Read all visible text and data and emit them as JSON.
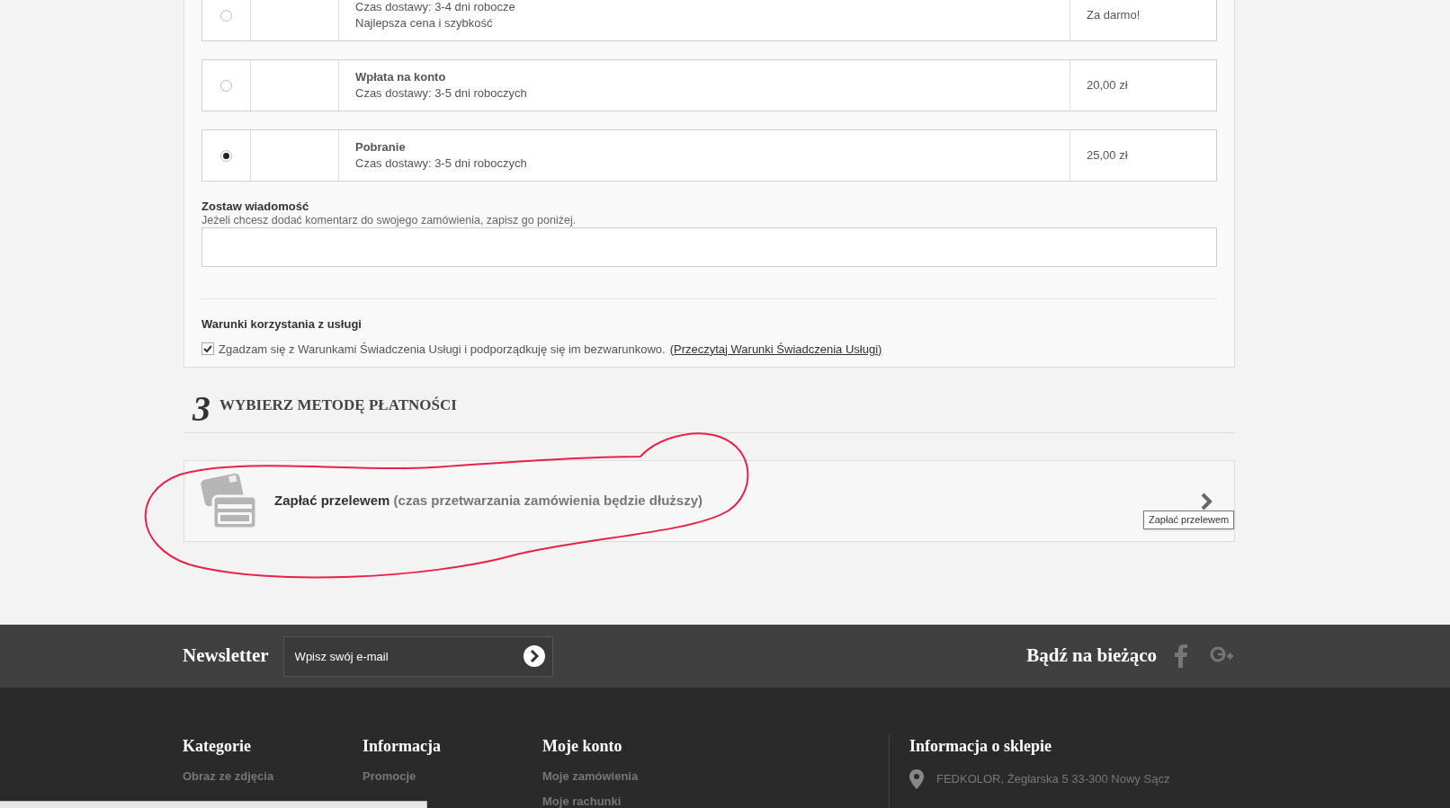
{
  "shipping_options": [
    {
      "selected": false,
      "lines": [
        "Czas dostawy: 3-4 dni robocze",
        "Najlepsza cena i szybkość"
      ],
      "price": "Za darmo!"
    },
    {
      "selected": false,
      "name": "Wpłata na konto",
      "lines": [
        "Czas dostawy: 3-5 dni roboczych"
      ],
      "price": "20,00 zł"
    },
    {
      "selected": true,
      "name": "Pobranie",
      "lines": [
        "Czas dostawy: 3-5 dni roboczych"
      ],
      "price": "25,00 zł"
    }
  ],
  "message": {
    "title": "Zostaw wiadomość",
    "hint": "Jeżeli chcesz dodać komentarz do swojego zamówienia, zapisz go poniżej."
  },
  "terms": {
    "title": "Warunki korzystania z usługi",
    "checked": true,
    "text": "Zgadzam się z Warunkami Świadczenia Usługi i podporządkuję się im bezwarunkowo.",
    "link": "(Przeczytaj Warunki Świadczenia Usługi)"
  },
  "payment_step": {
    "number": "3",
    "title": "WYBIERZ METODĘ PŁATNOŚCI",
    "method": "Zapłać przelewem",
    "note": "(czas przetwarzania zamówienia będzie dłuższy)",
    "tooltip": "Zapłać przelewem"
  },
  "newsletter": {
    "title": "Newsletter",
    "placeholder": "Wpisz swój e-mail",
    "social_title": "Bądź na bieżąco"
  },
  "footer": {
    "columns": [
      {
        "title": "Kategorie",
        "links": [
          "Obraz ze zdjęcia"
        ]
      },
      {
        "title": "Informacja",
        "links": [
          "Promocje"
        ]
      },
      {
        "title": "Moje konto",
        "links": [
          "Moje zamówienia",
          "Moje rachunki"
        ]
      }
    ],
    "shop_info": {
      "title": "Informacja o sklepie",
      "address": "FEDKOLOR, Żeglarska 5 33-300 Nowy Sącz"
    }
  }
}
